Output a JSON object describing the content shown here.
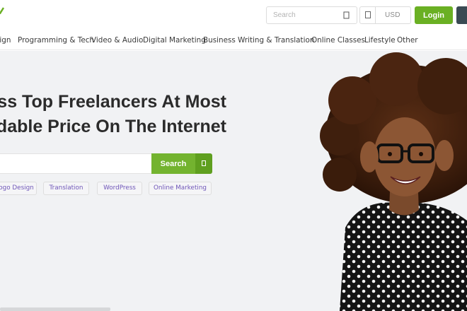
{
  "header": {
    "search_placeholder": "Search",
    "currency": "USD",
    "login_label": "Login",
    "logo_color": "#6ab023"
  },
  "categories": [
    "sign",
    "Programming & Tech",
    "Video & Audio",
    "Digital Marketing",
    "Business",
    "Writing & Translation",
    "Online Classes",
    "Lifestyle",
    "Other"
  ],
  "hero": {
    "title_line1": "ss Top Freelancers At Most",
    "title_line2": "dable Price On The Internet",
    "search_button": "Search",
    "tags": [
      "ogo Design",
      "Translation",
      "WordPress",
      "Online Marketing"
    ]
  },
  "icons": {
    "header_search": "search-icon",
    "currency": "currency-icon",
    "hero_search": "search-icon"
  },
  "colors": {
    "accent_green": "#6ab023",
    "tag_text": "#6f56b8",
    "hero_bg": "#f1f2f4",
    "dark_button": "#3a4a53"
  }
}
